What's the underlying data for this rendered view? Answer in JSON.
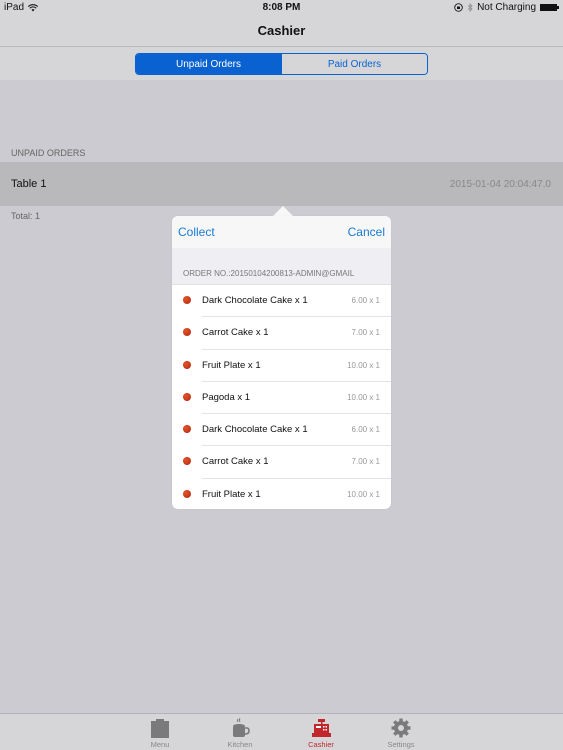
{
  "status_bar": {
    "device": "iPad",
    "time": "8:08 PM",
    "charging": "Not Charging"
  },
  "nav": {
    "title": "Cashier"
  },
  "segmented": {
    "options": [
      "Unpaid Orders",
      "Paid Orders"
    ],
    "selected": "Unpaid Orders"
  },
  "list": {
    "section_header": "UNPAID ORDERS",
    "orders": [
      {
        "name": "Table 1",
        "timestamp": "2015-01-04 20:04:47.0"
      }
    ],
    "total": "Total: 1"
  },
  "popover": {
    "collect_label": "Collect",
    "cancel_label": "Cancel",
    "order_number": "ORDER NO.:20150104200813-ADMIN@GMAIL",
    "items": [
      {
        "name": "Dark Chocolate Cake x 1",
        "price": "6.00 x 1"
      },
      {
        "name": "Carrot Cake x 1",
        "price": "7.00 x 1"
      },
      {
        "name": "Fruit Plate x 1",
        "price": "10.00 x 1"
      },
      {
        "name": "Pagoda x 1",
        "price": "10.00 x 1"
      },
      {
        "name": "Dark Chocolate Cake x 1",
        "price": "6.00 x 1"
      },
      {
        "name": "Carrot Cake x 1",
        "price": "7.00 x 1"
      },
      {
        "name": "Fruit Plate x 1",
        "price": "10.00 x 1"
      }
    ]
  },
  "tab_bar": {
    "tabs": [
      {
        "label": "Menu",
        "icon": "menu-icon"
      },
      {
        "label": "Kitchen",
        "icon": "coffee-cup-icon"
      },
      {
        "label": "Cashier",
        "icon": "cash-register-icon",
        "active": true
      },
      {
        "label": "Settings",
        "icon": "gear-icon"
      }
    ]
  },
  "colors": {
    "accent": "#0a62d1",
    "link": "#1a7ad6",
    "active_tab": "#c0262b",
    "item_dot": "#c0321a"
  }
}
